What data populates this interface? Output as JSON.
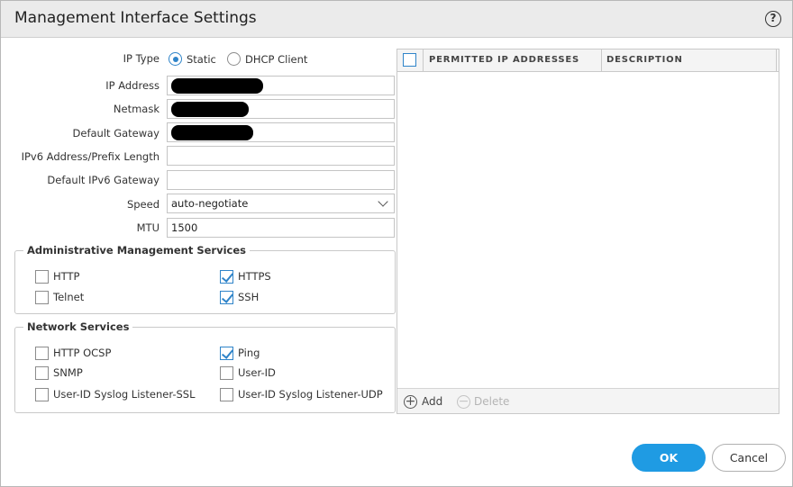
{
  "dialog": {
    "title": "Management Interface Settings",
    "help_glyph": "?"
  },
  "form": {
    "ip_type": {
      "label": "IP Type",
      "options": [
        "Static",
        "DHCP Client"
      ],
      "selected": "Static"
    },
    "ip_address": {
      "label": "IP Address",
      "value": ""
    },
    "netmask": {
      "label": "Netmask",
      "value": ""
    },
    "default_gateway": {
      "label": "Default Gateway",
      "value": ""
    },
    "ipv6_address": {
      "label": "IPv6 Address/Prefix Length",
      "value": ""
    },
    "ipv6_gateway": {
      "label": "Default IPv6 Gateway",
      "value": ""
    },
    "speed": {
      "label": "Speed",
      "value": "auto-negotiate"
    },
    "mtu": {
      "label": "MTU",
      "value": "1500"
    }
  },
  "admin_services": {
    "legend": "Administrative Management Services",
    "items": [
      {
        "label": "HTTP",
        "checked": false
      },
      {
        "label": "HTTPS",
        "checked": true
      },
      {
        "label": "Telnet",
        "checked": false
      },
      {
        "label": "SSH",
        "checked": true
      }
    ]
  },
  "network_services": {
    "legend": "Network Services",
    "items": [
      {
        "label": "HTTP OCSP",
        "checked": false
      },
      {
        "label": "Ping",
        "checked": true
      },
      {
        "label": "SNMP",
        "checked": false
      },
      {
        "label": "User-ID",
        "checked": false
      },
      {
        "label": "User-ID Syslog Listener-SSL",
        "checked": false
      },
      {
        "label": "User-ID Syslog Listener-UDP",
        "checked": false
      }
    ]
  },
  "permitted_ip_grid": {
    "columns": [
      "PERMITTED IP ADDRESSES",
      "DESCRIPTION"
    ],
    "rows": [],
    "add_label": "Add",
    "delete_label": "Delete",
    "add_glyph": "+",
    "delete_glyph": "−"
  },
  "footer": {
    "ok_label": "OK",
    "cancel_label": "Cancel"
  },
  "colors": {
    "accent": "#1f9be3",
    "check": "#2f84c9",
    "titlebar": "#ebebeb"
  }
}
